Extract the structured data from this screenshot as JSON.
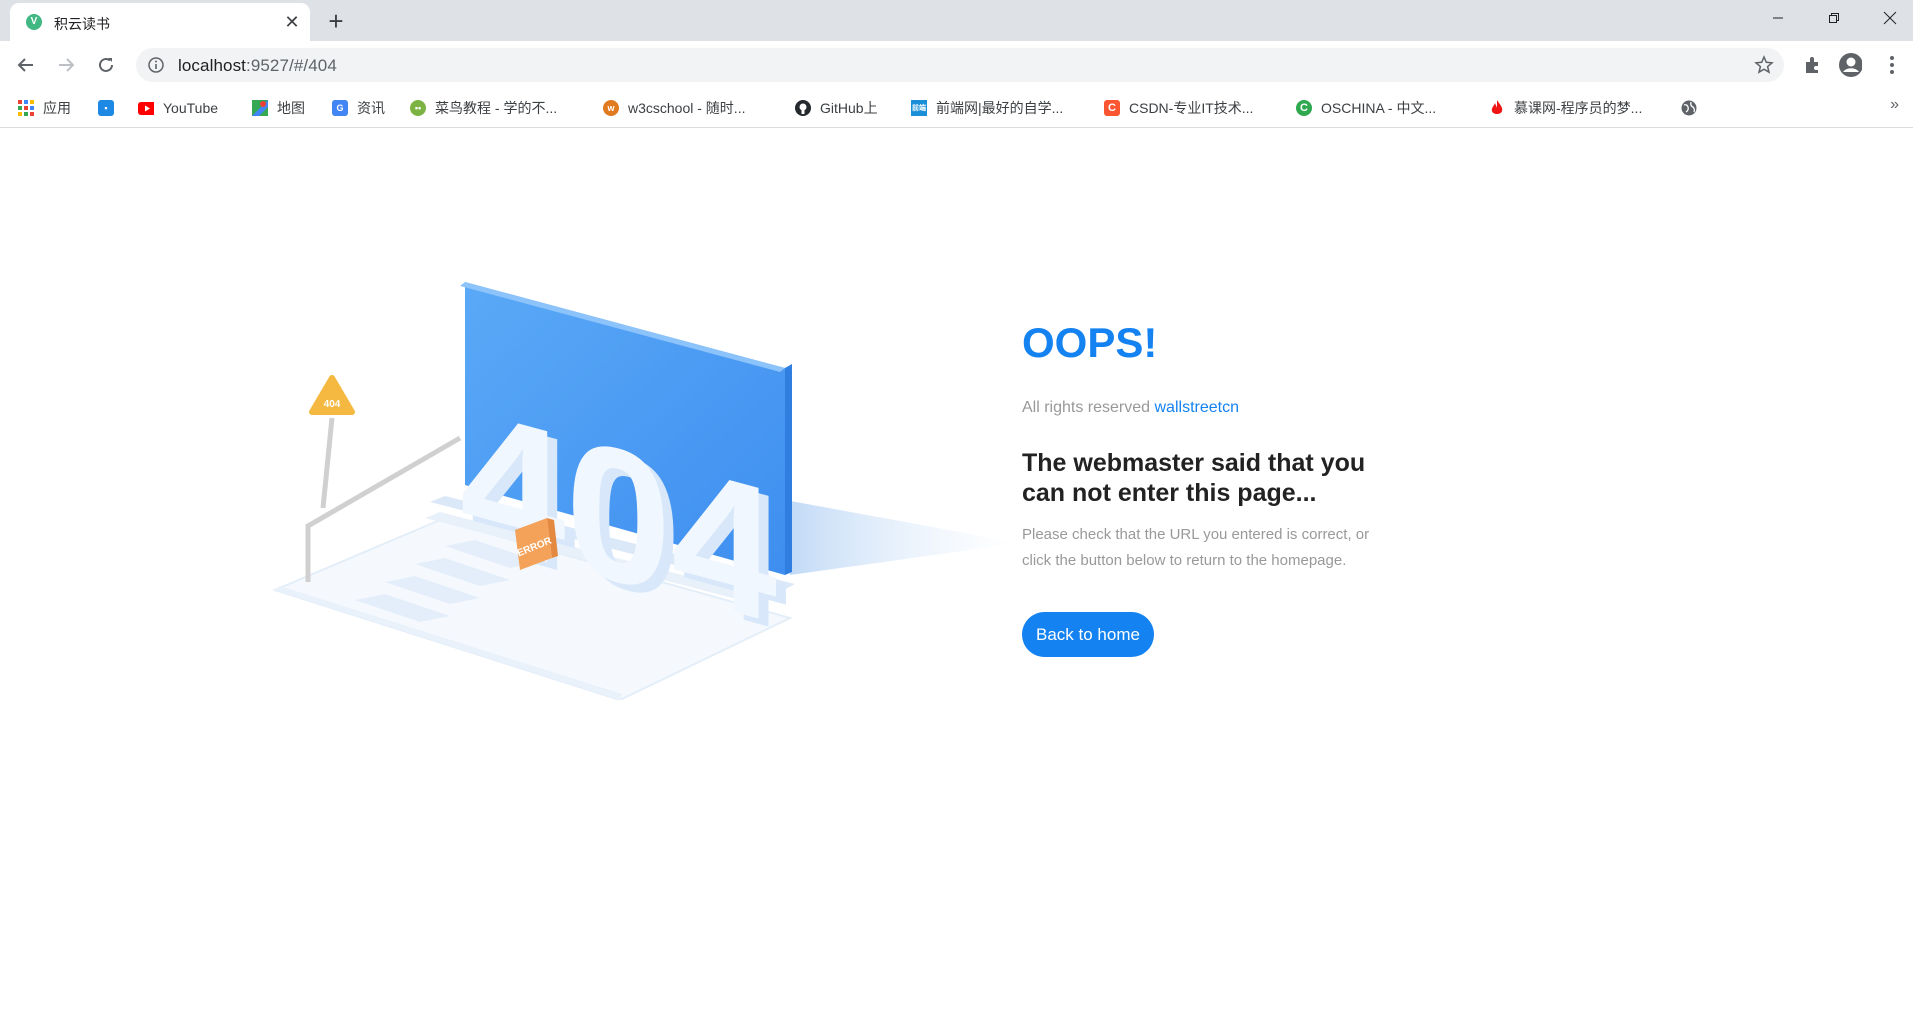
{
  "browser": {
    "tab": {
      "title": "积云读书",
      "favicon": "vue-logo-icon"
    },
    "address": {
      "host": "localhost",
      "rest": ":9527/#/404"
    }
  },
  "bookmarks": [
    {
      "label": "应用",
      "icon": "apps-grid-icon"
    },
    {
      "label": "",
      "icon": "game-icon"
    },
    {
      "label": "YouTube",
      "icon": "youtube-icon"
    },
    {
      "label": "地图",
      "icon": "maps-icon"
    },
    {
      "label": "资讯",
      "icon": "news-icon"
    },
    {
      "label": "菜鸟教程 - 学的不...",
      "icon": "runoob-icon"
    },
    {
      "label": "w3cschool - 随时...",
      "icon": "w3cschool-icon"
    },
    {
      "label": "GitHub上",
      "icon": "github-icon"
    },
    {
      "label": "前端网|最好的自学...",
      "icon": "qianduan-icon"
    },
    {
      "label": "CSDN-专业IT技术...",
      "icon": "csdn-icon"
    },
    {
      "label": "OSCHINA - 中文...",
      "icon": "oschina-icon"
    },
    {
      "label": "慕课网-程序员的梦...",
      "icon": "imooc-icon"
    },
    {
      "label": "",
      "icon": "globe-icon"
    }
  ],
  "illustration": {
    "sign_text": "404",
    "error_sign_text": "ERROR",
    "big_text": "404"
  },
  "page": {
    "oops": "OOPS!",
    "rights_prefix": "All rights reserved",
    "rights_link": "wallstreetcn",
    "headline": "The webmaster said that you can not enter this page...",
    "info": "Please check that the URL you entered is correct, or click the button below to return to the homepage.",
    "button": "Back to home"
  },
  "colors": {
    "accent": "#1482f0",
    "screen_blue": "#4a9ff5",
    "warning": "#f5b942",
    "error_sign": "#f4a25a"
  }
}
